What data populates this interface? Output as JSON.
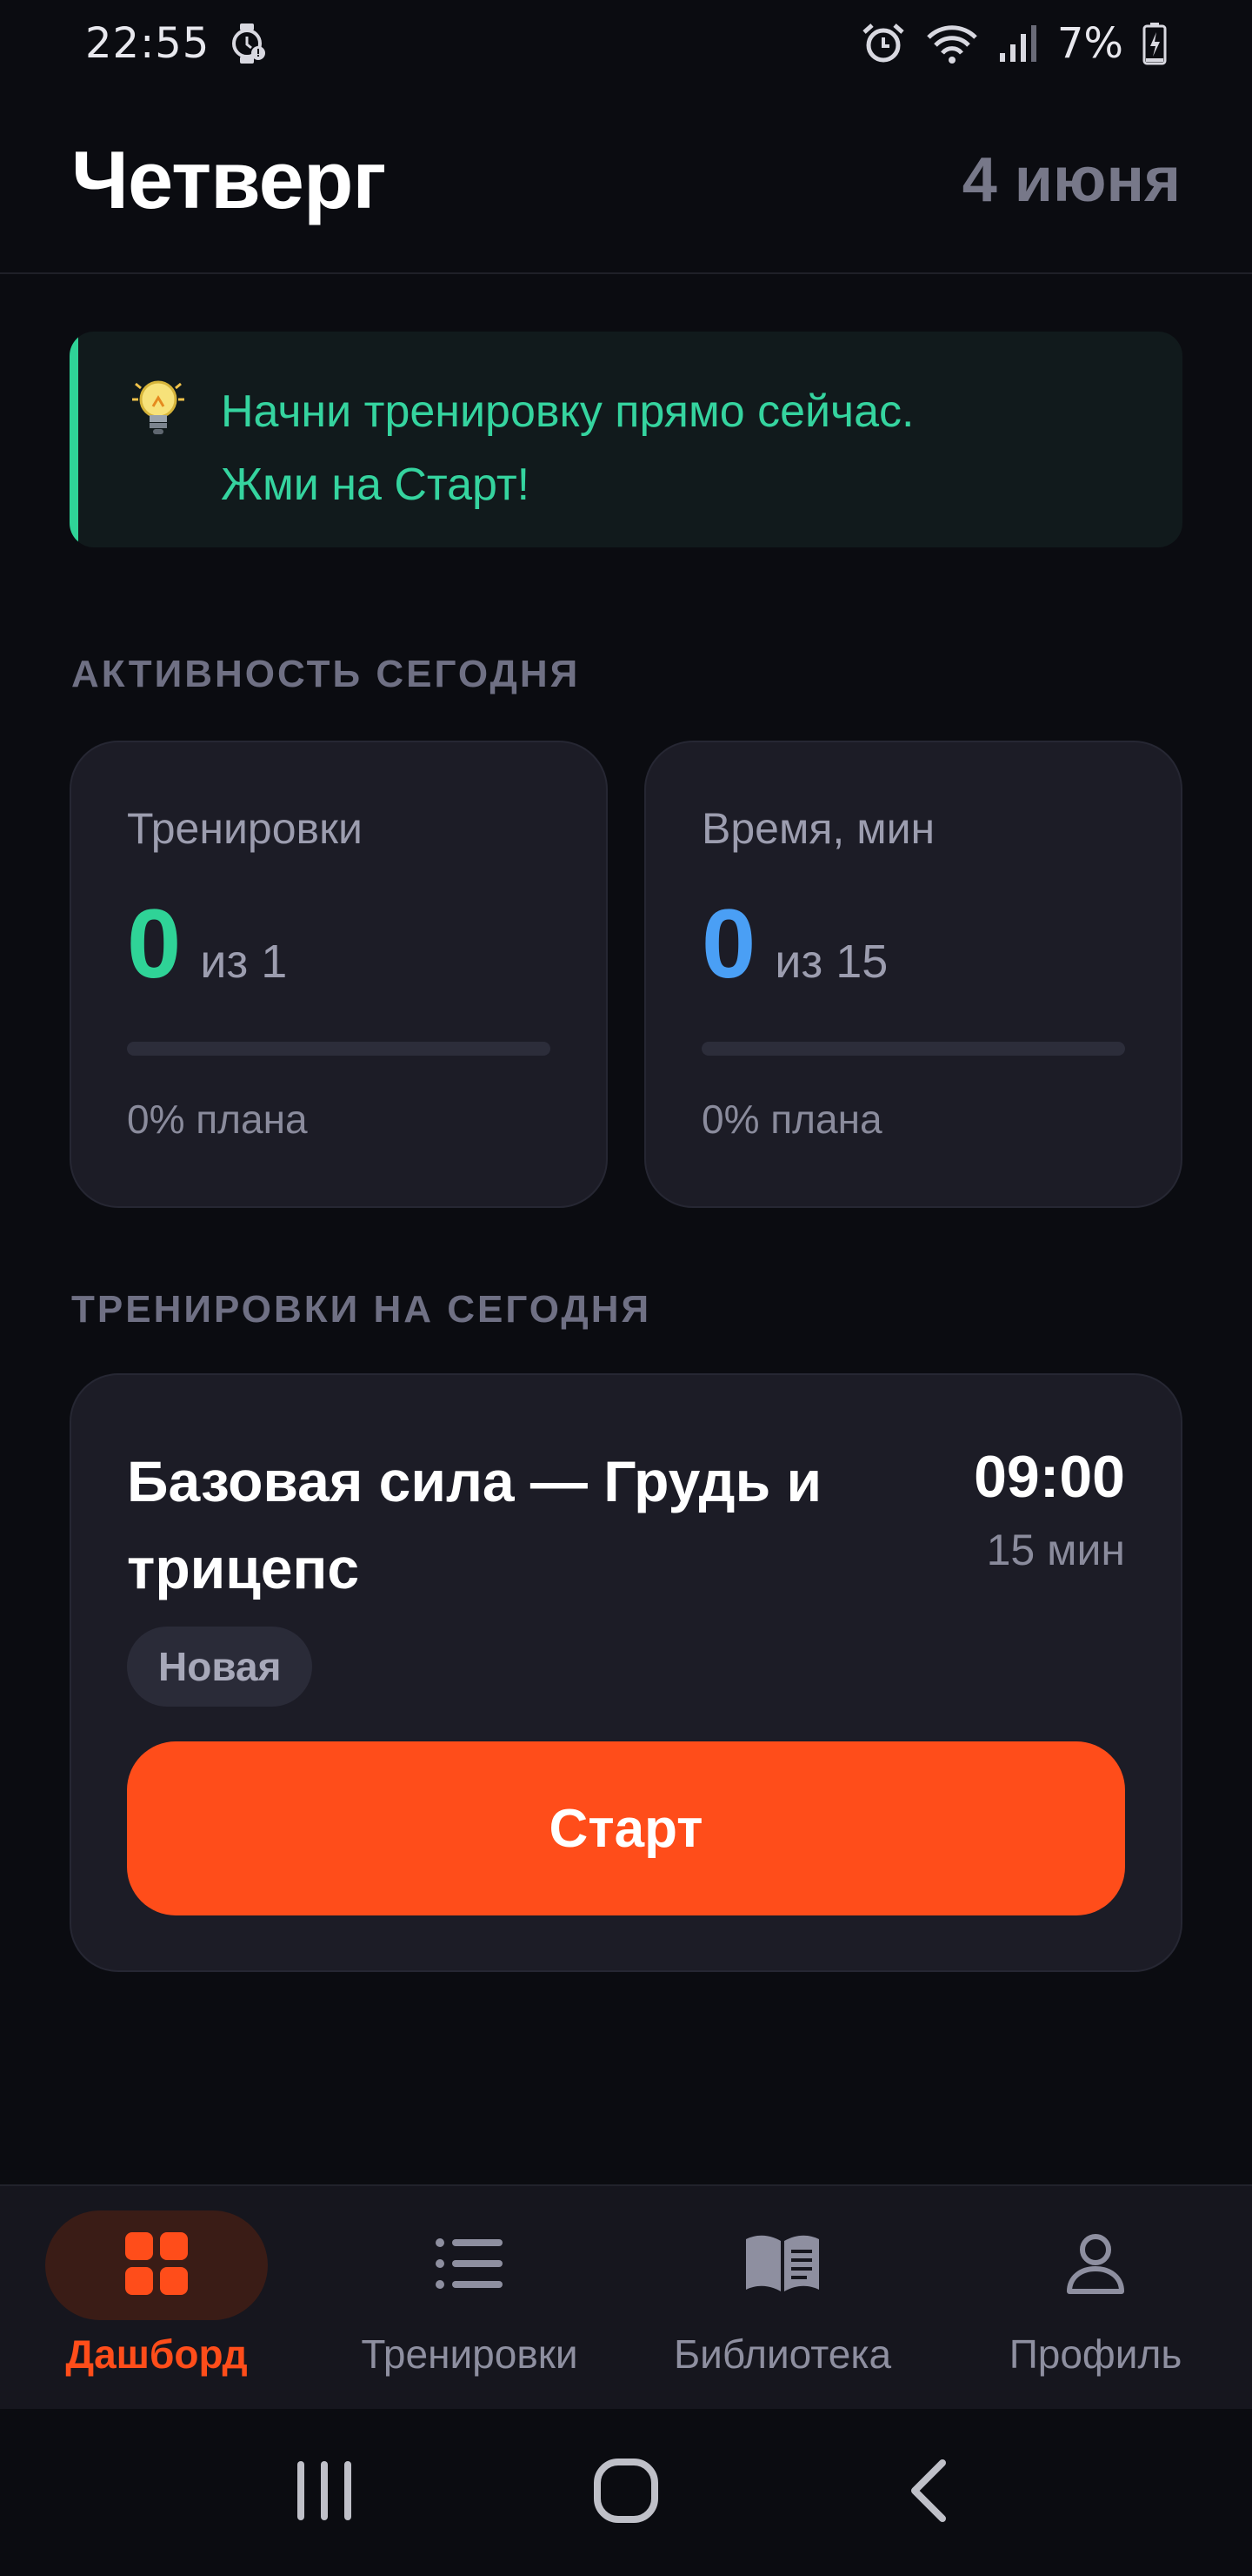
{
  "status_bar": {
    "time": "22:55",
    "battery": "7%",
    "icons": [
      "watch-alert-icon",
      "alarm-icon",
      "wifi-icon",
      "signal-icon",
      "battery-charging-icon"
    ]
  },
  "header": {
    "title": "Четверг",
    "date": "4 июня"
  },
  "tip": {
    "icon": "lightbulb-icon",
    "text_line1": "Начни тренировку прямо сейчас.",
    "text_line2": "Жми на Старт!"
  },
  "activity": {
    "section_title": "АКТИВНОСТЬ СЕГОДНЯ",
    "cards": [
      {
        "label": "Тренировки",
        "value": "0",
        "of": "из 1",
        "percent_text": "0% плана",
        "progress": 0,
        "accent": "#2fd397"
      },
      {
        "label": "Время, мин",
        "value": "0",
        "of": "из 15",
        "percent_text": "0% плана",
        "progress": 0,
        "accent": "#4a9ff5"
      }
    ]
  },
  "workouts": {
    "section_title": "ТРЕНИРОВКИ НА СЕГОДНЯ",
    "items": [
      {
        "name": "Базовая сила — Грудь и трицепс",
        "time": "09:00",
        "duration": "15 мин",
        "badge": "Новая",
        "start_label": "Старт"
      }
    ]
  },
  "bottom_nav": {
    "items": [
      {
        "label": "Дашборд",
        "icon": "dashboard-grid-icon",
        "active": true
      },
      {
        "label": "Тренировки",
        "icon": "list-icon",
        "active": false
      },
      {
        "label": "Библиотека",
        "icon": "book-icon",
        "active": false
      },
      {
        "label": "Профиль",
        "icon": "profile-icon",
        "active": false
      }
    ]
  },
  "colors": {
    "background": "#0b0c11",
    "accent": "#ff4d1a",
    "green": "#2fd397",
    "blue": "#4a9ff5",
    "card": "#1c1c26"
  }
}
